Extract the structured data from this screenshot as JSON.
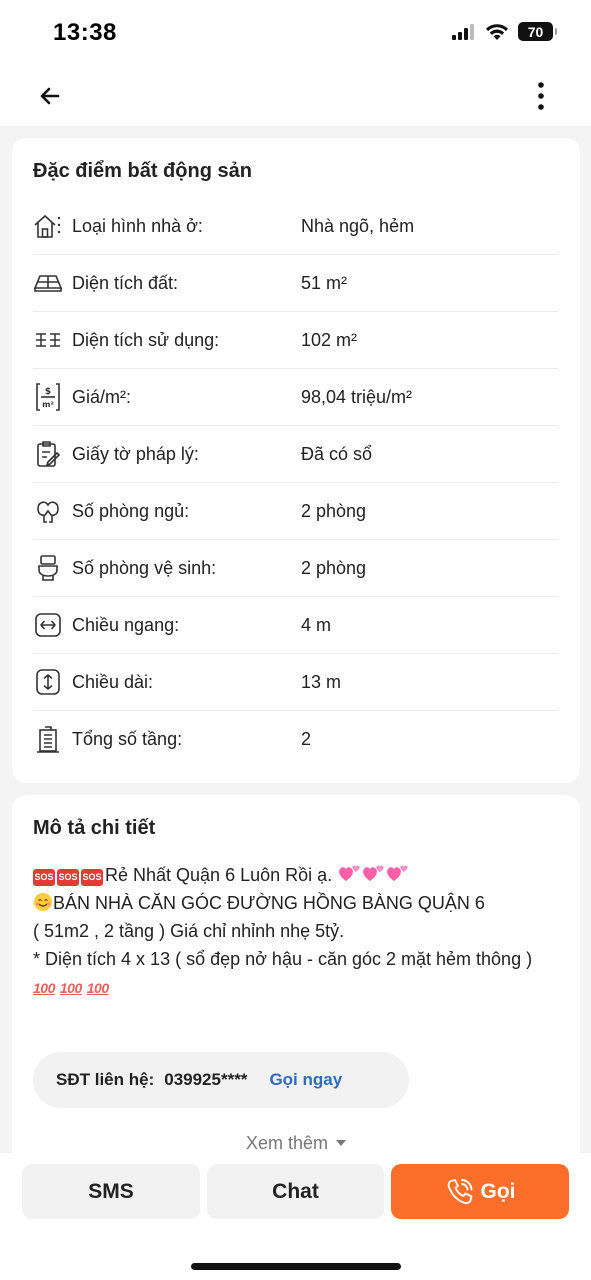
{
  "status_bar": {
    "time": "13:38",
    "battery": "70"
  },
  "specs": {
    "title": "Đặc điểm bất động sản",
    "rows": [
      {
        "icon": "house-type-icon",
        "label": "Loại hình nhà ở:",
        "value": "Nhà ngõ, hẻm"
      },
      {
        "icon": "land-area-icon",
        "label": "Diện tích đất:",
        "value": "51 m²"
      },
      {
        "icon": "floor-area-icon",
        "label": "Diện tích sử dụng:",
        "value": "102 m²"
      },
      {
        "icon": "price-per-m2-icon",
        "label": "Giá/m²:",
        "value": "98,04 triệu/m²"
      },
      {
        "icon": "legal-document-icon",
        "label": "Giấy tờ pháp lý:",
        "value": "Đã có sổ"
      },
      {
        "icon": "bedroom-icon",
        "label": "Số phòng ngủ:",
        "value": "2 phòng"
      },
      {
        "icon": "toilet-icon",
        "label": "Số phòng vệ sinh:",
        "value": "2 phòng"
      },
      {
        "icon": "width-icon",
        "label": "Chiều ngang:",
        "value": "4 m"
      },
      {
        "icon": "length-icon",
        "label": "Chiều dài:",
        "value": "13 m"
      },
      {
        "icon": "floors-icon",
        "label": "Tổng số tầng:",
        "value": "2"
      }
    ]
  },
  "description": {
    "title": "Mô tả chi tiết",
    "sos_text": "SOS",
    "line1": "Rẻ Nhất Quận 6 Luôn Rồi ạ. ",
    "line2": "BÁN NHÀ CĂN GÓC ĐƯỜNG HỒNG BÀNG QUẬN 6",
    "line3": "( 51m2 , 2 tầng ) Giá chỉ nhỉnh nhẹ 5tỷ.",
    "line4": "* Diện tích 4 x 13 ( sổ đẹp nở hậu - căn góc 2 mặt hẻm thông )",
    "hundred_text": "100",
    "phone_label": "SĐT liên hệ:",
    "phone_number": "039925****",
    "call_now": "Gọi ngay",
    "see_more": "Xem thêm"
  },
  "bottom_bar": {
    "sms": "SMS",
    "chat": "Chat",
    "call": "Gọi"
  },
  "colors": {
    "accent": "#fe6e2b",
    "link": "#2d6bc4",
    "sos": "#e53935"
  }
}
